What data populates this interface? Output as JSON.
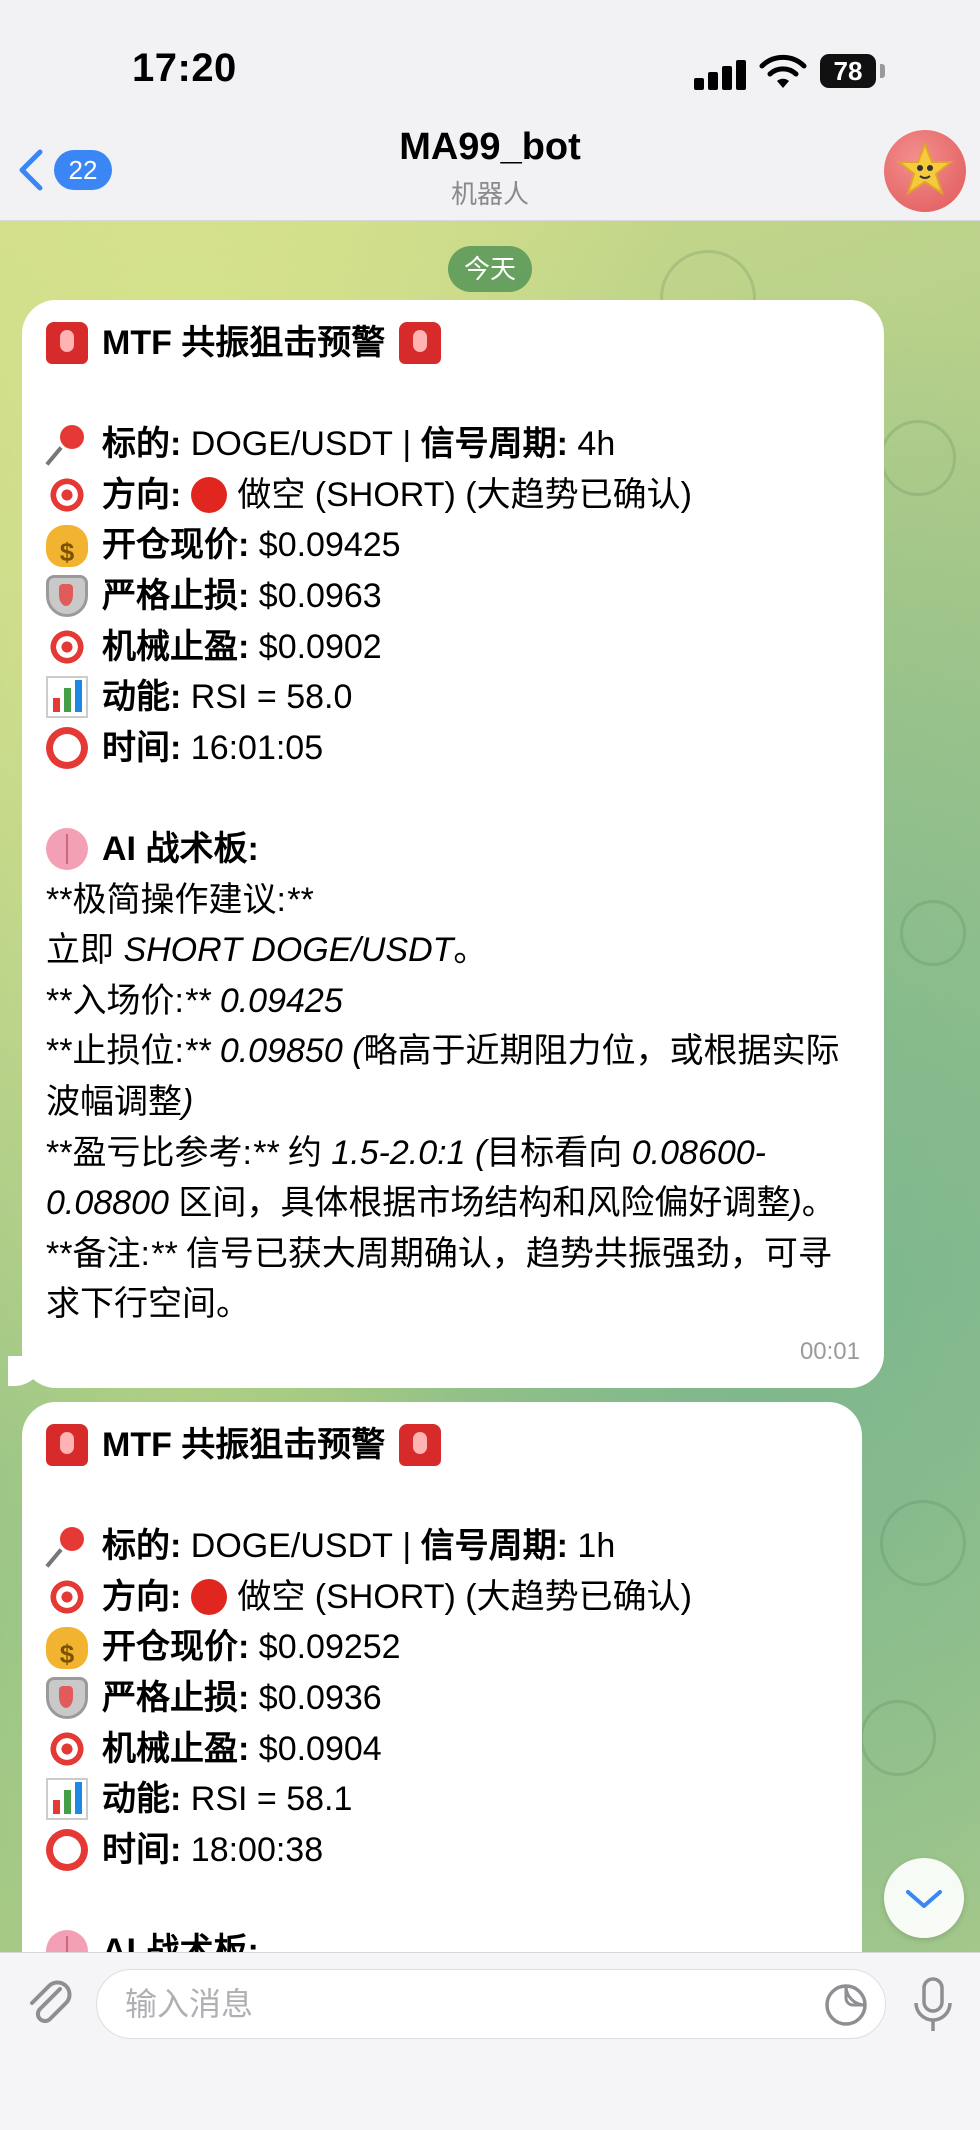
{
  "status_bar": {
    "time": "17:20",
    "battery": "78"
  },
  "header": {
    "back_count": "22",
    "title": "MA99_bot",
    "subtitle": "机器人"
  },
  "date_label": "今天",
  "messages": [
    {
      "title": "MTF 共振狙击预警",
      "symbol_label": "标的:",
      "symbol": "DOGE/USDT",
      "period_label": "信号周期:",
      "period": "4h",
      "direction_label": "方向:",
      "direction": "做空 (SHORT) (大趋势已确认)",
      "entry_label": "开仓现价:",
      "entry": "$0.09425",
      "stop_label": "严格止损:",
      "stop": "$0.0963",
      "tp_label": "机械止盈:",
      "tp": "$0.0902",
      "momentum_label": "动能:",
      "momentum": "RSI = 58.0",
      "time_label": "时间:",
      "time": "16:01:05",
      "ai_label": "AI 战术板:",
      "ai_lines": {
        "l1_pre": "**极简操作建议:",
        "l1_post": "**",
        "l2_a": "立即 ",
        "l2_b": "SHORT DOGE/USDT",
        "l2_c": "。",
        "l3_a": "**入场价:",
        "l3_b": "** 0.09425",
        "l4_a": "**止损位:",
        "l4_b": "** 0.09850 (",
        "l4_c": "略高于近期阻力位，或根据实际波幅调整",
        "l4_d": ")",
        "l5_a": "**盈亏比参考:",
        "l5_b": "** ",
        "l5_c": "约 ",
        "l5_d": "1.5-2.0:1 (",
        "l5_e": "目标看向 ",
        "l5_f": "0.08600-0.08800",
        "l5_g": " 区间，具体根据市场结构和风险偏好调整",
        "l5_h": ")",
        "l5_i": "。",
        "l6_a": "**备注:",
        "l6_b": "** ",
        "l6_c": "信号已获大周期确认，趋势共振强劲，可寻求下行空间。"
      },
      "timestamp": "00:01"
    },
    {
      "title": "MTF 共振狙击预警",
      "symbol_label": "标的:",
      "symbol": "DOGE/USDT",
      "period_label": "信号周期:",
      "period": "1h",
      "direction_label": "方向:",
      "direction": "做空 (SHORT) (大趋势已确认)",
      "entry_label": "开仓现价:",
      "entry": "$0.09252",
      "stop_label": "严格止损:",
      "stop": "$0.0936",
      "tp_label": "机械止盈:",
      "tp": "$0.0904",
      "momentum_label": "动能:",
      "momentum": "RSI = 58.1",
      "time_label": "时间:",
      "time": "18:00:38",
      "ai_label": "AI 战术板:"
    }
  ],
  "composer": {
    "placeholder": "输入消息"
  },
  "icons": {
    "back": "chevron-left-icon",
    "avatar": "star-face-icon",
    "scroll": "chevron-down-icon",
    "attach": "paperclip-icon",
    "sticker": "sticker-icon",
    "mic": "microphone-icon"
  },
  "colors": {
    "accent": "#3a86f5",
    "date_pill": "#4a9c5a",
    "bubble": "#ffffff"
  }
}
